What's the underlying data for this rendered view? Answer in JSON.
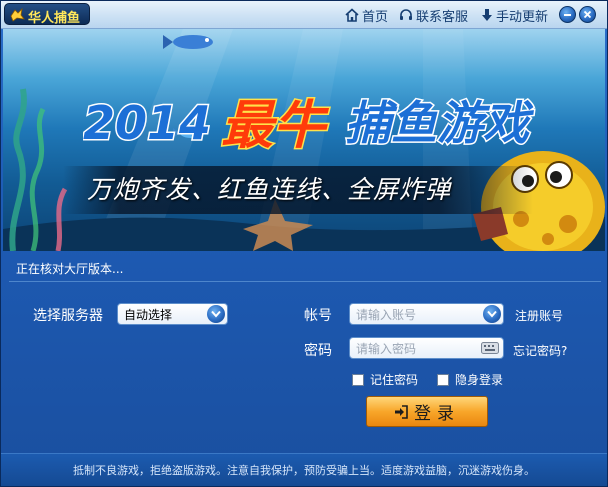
{
  "window": {
    "title": "华人捕鱼",
    "nav": {
      "home": "首页",
      "service": "联系客服",
      "update": "手动更新"
    }
  },
  "banner": {
    "year": "2014",
    "highlight": "最牛",
    "title": "捕鱼游戏",
    "slogan": "万炮齐发、红鱼连线、全屏炸弹"
  },
  "status": {
    "text": "正在核对大厅版本..."
  },
  "login": {
    "server_label": "选择服务器",
    "server_value": "自动选择",
    "account_label": "帐号",
    "account_placeholder": "请输入账号",
    "password_label": "密码",
    "password_placeholder": "请输入密码",
    "register_link": "注册账号",
    "forgot_link": "忘记密码?",
    "remember_password": "记住密码",
    "invisible_login": "隐身登录",
    "login_button": "登录"
  },
  "footer": {
    "notice": "抵制不良游戏，拒绝盗版游戏。注意自我保护，预防受骗上当。适度游戏益脑，沉迷游戏伤身。"
  },
  "colors": {
    "title_text": "#ffe65a",
    "headline_red": "#ff3b0a",
    "headline_blue": "#1c6fd6",
    "login_button": "#f8a62a"
  }
}
